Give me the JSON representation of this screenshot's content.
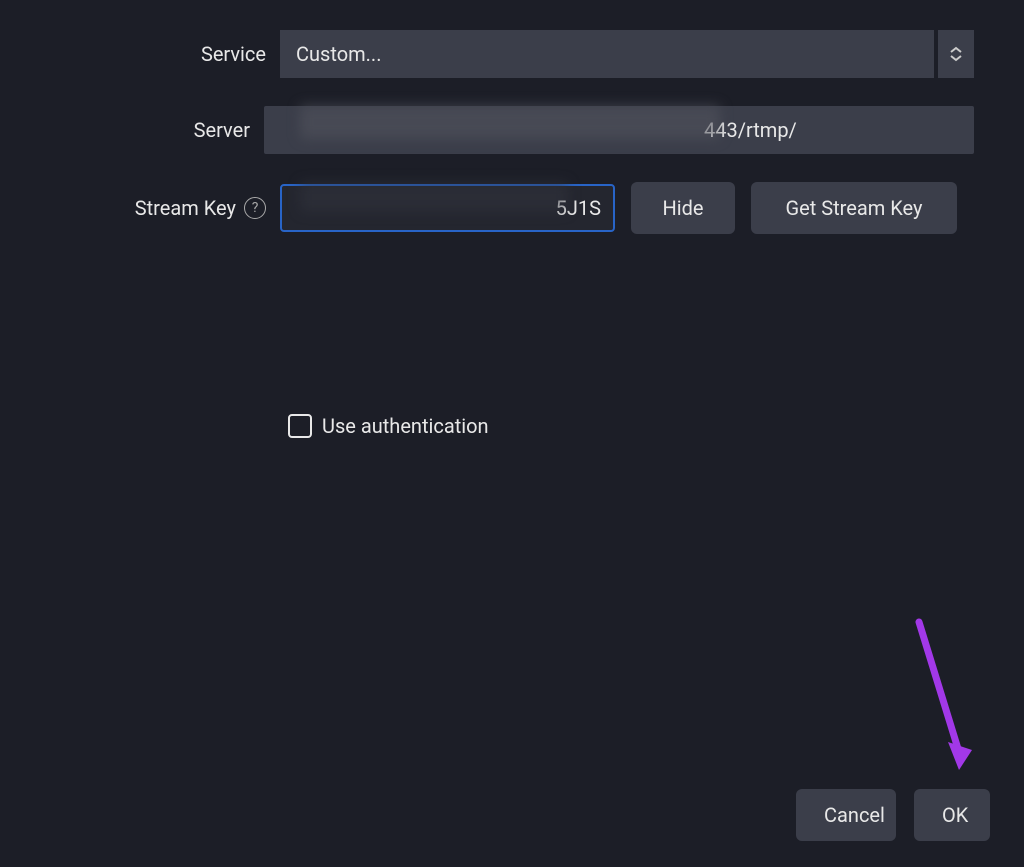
{
  "labels": {
    "service": "Service",
    "server": "Server",
    "stream_key": "Stream Key",
    "use_auth": "Use authentication"
  },
  "values": {
    "service_selected": "Custom...",
    "server_value": "443/rtmp/",
    "stream_key_value": "5J1S"
  },
  "buttons": {
    "hide": "Hide",
    "get_stream_key": "Get Stream Key",
    "cancel": "Cancel",
    "ok": "OK"
  },
  "icons": {
    "help": "?"
  },
  "checkbox": {
    "use_auth_checked": false
  }
}
